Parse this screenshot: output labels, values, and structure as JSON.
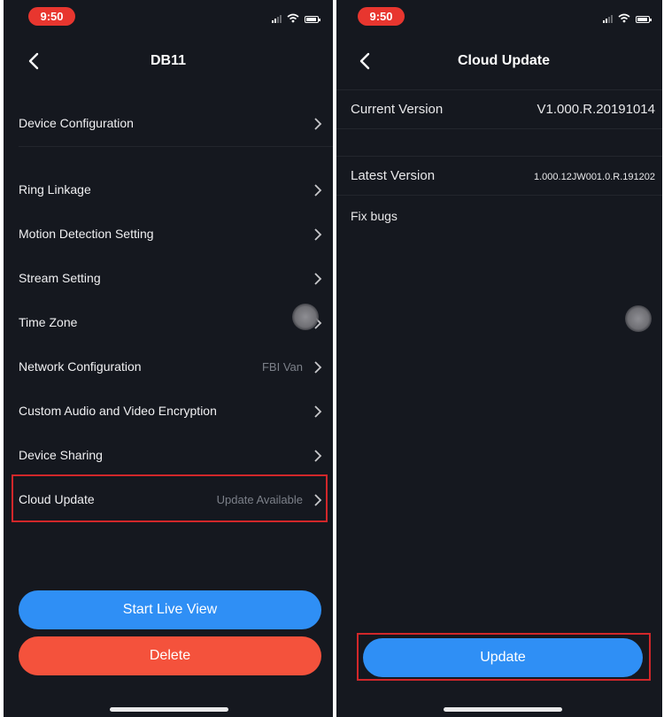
{
  "left_screen": {
    "status": {
      "time": "9:50"
    },
    "nav": {
      "title": "DB11"
    },
    "menu": [
      {
        "label": "Device Configuration",
        "value": ""
      },
      {
        "label": "Ring Linkage",
        "value": ""
      },
      {
        "label": "Motion Detection Setting",
        "value": ""
      },
      {
        "label": "Stream Setting",
        "value": ""
      },
      {
        "label": "Time Zone",
        "value": ""
      },
      {
        "label": "Network Configuration",
        "value": "FBI Van"
      },
      {
        "label": "Custom Audio and Video Encryption",
        "value": ""
      },
      {
        "label": "Device Sharing",
        "value": ""
      },
      {
        "label": "Cloud Update",
        "value": "Update Available"
      }
    ],
    "buttons": {
      "live_view": "Start Live View",
      "delete": "Delete"
    }
  },
  "right_screen": {
    "status": {
      "time": "9:50"
    },
    "nav": {
      "title": "Cloud Update"
    },
    "current_version": {
      "label": "Current Version",
      "value": "V1.000.R.20191014"
    },
    "latest_version": {
      "label": "Latest Version",
      "value": "1.000.12JW001.0.R.191202"
    },
    "release_notes": "Fix bugs",
    "buttons": {
      "update": "Update"
    }
  },
  "colors": {
    "background": "#15181f",
    "accent_blue": "#2f8ff5",
    "danger_red": "#f4523c",
    "highlight_box": "#d1272a",
    "time_pill": "#e8362f"
  },
  "icons": [
    "back-chevron-icon",
    "chevron-right-icon",
    "signal-icon",
    "wifi-icon",
    "battery-icon"
  ]
}
